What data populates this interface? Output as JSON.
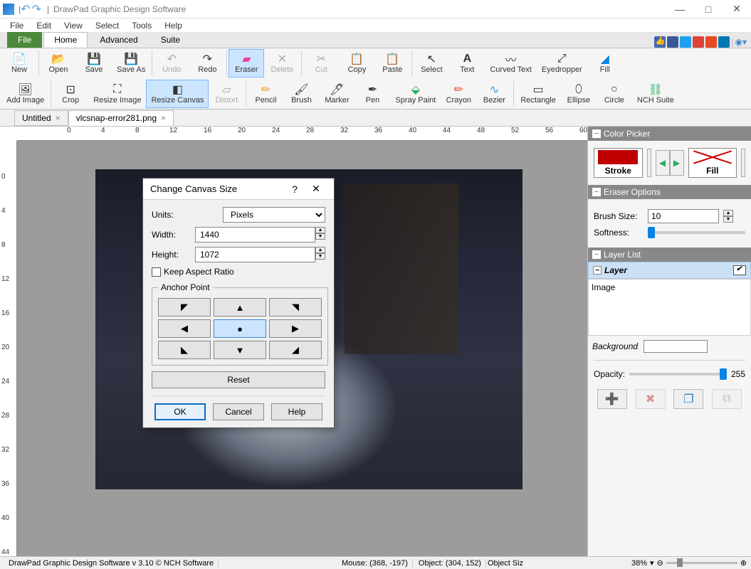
{
  "app": {
    "title": "DrawPad Graphic Design Software"
  },
  "menubar": [
    "File",
    "Edit",
    "View",
    "Select",
    "Tools",
    "Help"
  ],
  "ribbontabs": {
    "file": "File",
    "home": "Home",
    "advanced": "Advanced",
    "suite": "Suite"
  },
  "ribbon_row1": {
    "new": "New",
    "open": "Open",
    "save": "Save",
    "saveas": "Save As",
    "undo": "Undo",
    "redo": "Redo",
    "eraser": "Eraser",
    "delete": "Delete",
    "cut": "Cut",
    "copy": "Copy",
    "paste": "Paste",
    "select": "Select",
    "text": "Text",
    "curvedtext": "Curved Text",
    "eyedropper": "Eyedropper",
    "fill": "Fill"
  },
  "ribbon_row2": {
    "addimage": "Add Image",
    "crop": "Crop",
    "resizeimage": "Resize Image",
    "resizecanvas": "Resize Canvas",
    "distort": "Distort",
    "pencil": "Pencil",
    "brush": "Brush",
    "marker": "Marker",
    "pen": "Pen",
    "spraypaint": "Spray Paint",
    "crayon": "Crayon",
    "bezier": "Bezier",
    "rectangle": "Rectangle",
    "ellipse": "Ellipse",
    "circle": "Circle",
    "nchsuite": "NCH Suite"
  },
  "doctabs": {
    "tab1": "Untitled",
    "tab2": "vlcsnap-error281.png"
  },
  "ruler_h": [
    0,
    4,
    8,
    12,
    16,
    20,
    24,
    28,
    32,
    36,
    40,
    44,
    48,
    52,
    56,
    60
  ],
  "ruler_v": [
    0,
    4,
    8,
    12,
    16,
    20,
    24,
    28,
    32,
    36,
    40,
    44
  ],
  "panels": {
    "colorpicker": {
      "title": "Color Picker",
      "stroke": "Stroke",
      "fill": "Fill"
    },
    "eraser": {
      "title": "Eraser Options",
      "brushsize": "Brush Size:",
      "brushsize_val": "10",
      "softness": "Softness:"
    },
    "layerlist": {
      "title": "Layer List",
      "layer": "Layer",
      "item": "Image",
      "background": "Background",
      "opacity": "Opacity:",
      "opacity_val": "255"
    }
  },
  "statusbar": {
    "app": "DrawPad Graphic Design Software v 3.10 © NCH Software",
    "mouse": "Mouse: (368, -197)",
    "object": "Object: (304, 152)",
    "objsize": "Object Siz",
    "zoom": "38%"
  },
  "dialog": {
    "title": "Change Canvas Size",
    "units": "Units:",
    "units_val": "Pixels",
    "width": "Width:",
    "width_val": "1440",
    "height": "Height:",
    "height_val": "1072",
    "keepratio": "Keep Aspect Ratio",
    "anchor": "Anchor Point",
    "reset": "Reset",
    "ok": "OK",
    "cancel": "Cancel",
    "help": "Help"
  }
}
